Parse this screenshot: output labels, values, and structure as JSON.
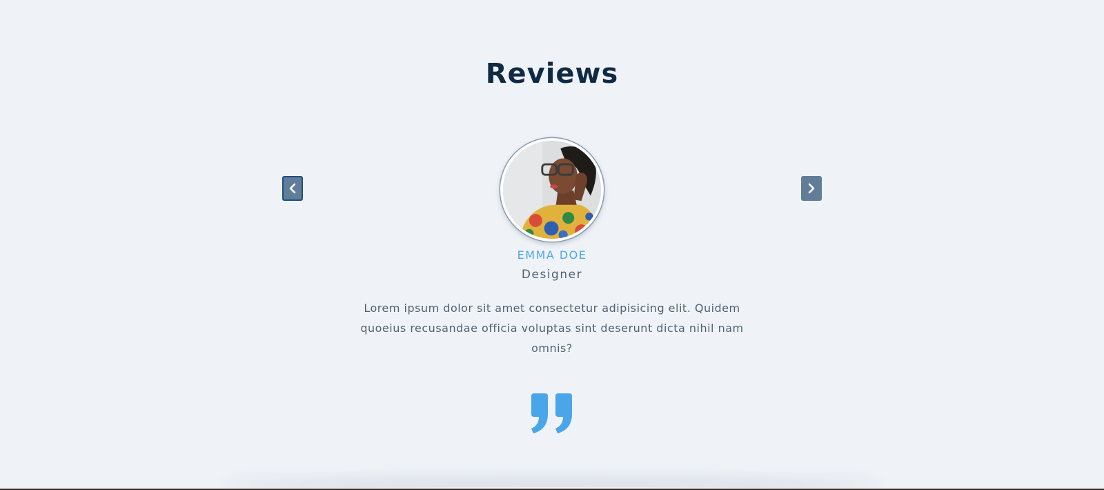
{
  "section": {
    "title": "Reviews"
  },
  "review": {
    "name": "EMMA DOE",
    "job": "Designer",
    "text": "Lorem ipsum dolor sit amet consectetur adipisicing elit. Quidem quoeius recusandae officia voluptas sint deserunt dicta nihil nam omnis?",
    "avatar_icon": "person-photo-avatar",
    "quote_icon": "quote-right-icon"
  },
  "controls": {
    "prev_icon": "chevron-left-icon",
    "next_icon": "chevron-right-icon"
  },
  "colors": {
    "background": "#eff3f8",
    "title": "#102a43",
    "accent": "#49a6e9",
    "button": "#617d98",
    "text": "#52606d"
  }
}
